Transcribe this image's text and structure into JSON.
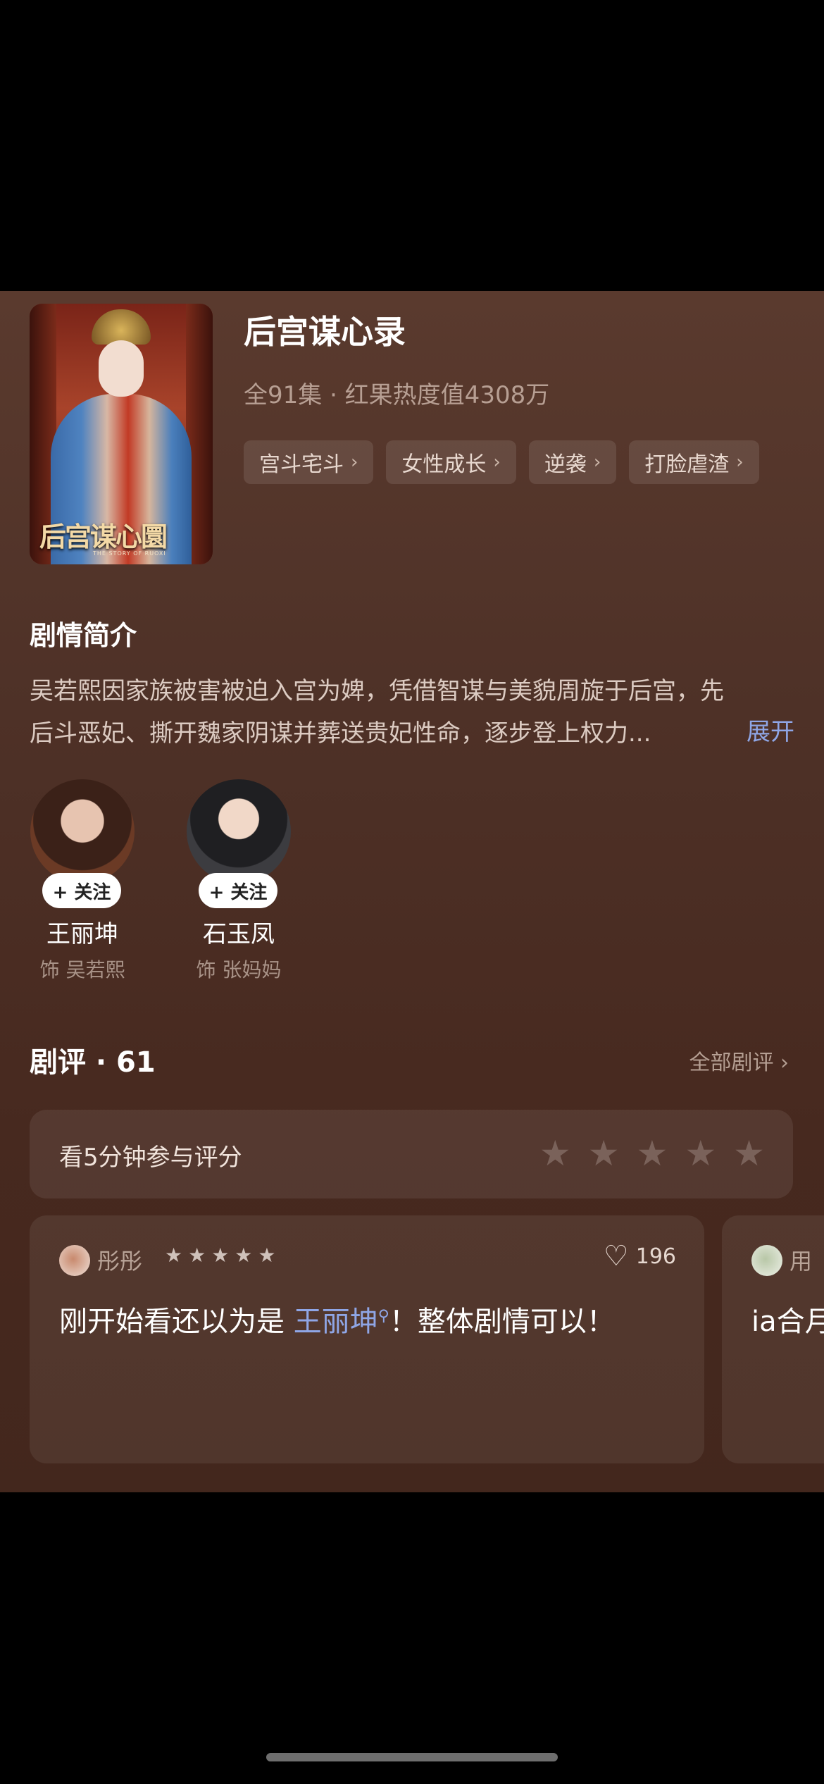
{
  "drama": {
    "title": "后宫谋心录",
    "meta": "全91集 · 红果热度值4308万",
    "poster_title": "后宫谋心圜",
    "poster_sub": "THE STORY OF RUOXI",
    "tags": [
      "宫斗宅斗",
      "女性成长",
      "逆袭",
      "打脸虐渣"
    ]
  },
  "synopsis": {
    "heading": "剧情简介",
    "line1": "吴若熙因家族被害被迫入宫为婢，凭借智谋与美貌周旋于后宫，先",
    "line2": "后斗恶妃、撕开魏家阴谋并葬送贵妃性命，逐步登上权力...",
    "expand": "展开"
  },
  "cast": [
    {
      "name": "王丽坤",
      "role": "饰 吴若熙",
      "follow": "+ 关注"
    },
    {
      "name": "石玉凤",
      "role": "饰 张妈妈",
      "follow": "+ 关注"
    }
  ],
  "reviews": {
    "title": "剧评 · 61",
    "all": "全部剧评 ›",
    "rate_prompt": "看5分钟参与评分",
    "items": [
      {
        "user": "彤彤",
        "stars": "★★★★★",
        "likes": "196",
        "text_pre": "刚开始看还以为是 ",
        "text_link": "王丽坤",
        "text_post": "！整体剧情可以！"
      },
      {
        "user": "用",
        "text": "ia合月"
      }
    ]
  },
  "icons": {
    "chevron": "chevron-right-icon",
    "heart": "heart-outline-icon",
    "star": "star-icon"
  },
  "colors": {
    "link": "#8fa6e6",
    "background": "#4e3127"
  }
}
